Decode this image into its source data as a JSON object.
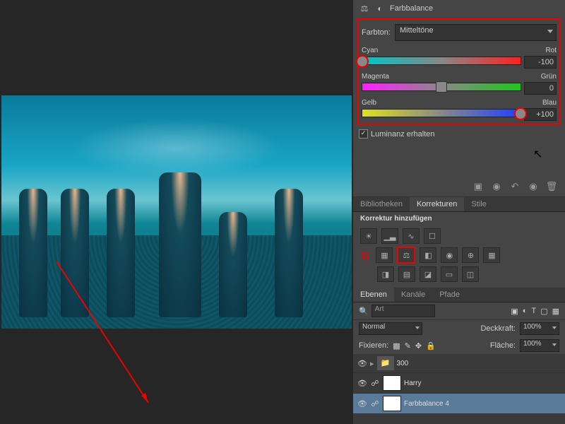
{
  "panel_title": "Farbbalance",
  "tone": {
    "label": "Farbton:",
    "value": "Mitteltöne"
  },
  "sliders": [
    {
      "left": "Cyan",
      "right": "Rot",
      "value": "-100",
      "pos": 0,
      "gradient": "linear-gradient(90deg,#00c5c5,#888,#ff2020)",
      "hl": true
    },
    {
      "left": "Magenta",
      "right": "Grün",
      "value": "0",
      "pos": 50,
      "gradient": "linear-gradient(90deg,#ff20ff,#888,#20c520)",
      "hl": false
    },
    {
      "left": "Gelb",
      "right": "Blau",
      "value": "+100",
      "pos": 100,
      "gradient": "linear-gradient(90deg,#e0e020,#888,#2040ff)",
      "hl": true
    }
  ],
  "preserve_lum": "Luminanz erhalten",
  "tabs1": {
    "items": [
      "Bibliotheken",
      "Korrekturen",
      "Stile"
    ],
    "active": 1
  },
  "add_adj": "Korrektur hinzufügen",
  "annot1": "1)",
  "tabs2": {
    "items": [
      "Ebenen",
      "Kanäle",
      "Pfade"
    ],
    "active": 0
  },
  "search_placeholder": "Art",
  "blend": "Normal",
  "opacity_label": "Deckkraft:",
  "opacity_value": "100%",
  "lock_label": "Fixieren:",
  "fill_label": "Fläche:",
  "fill_value": "100%",
  "layers": [
    {
      "name": "300",
      "type": "group",
      "eye": true,
      "sel": false
    },
    {
      "name": "Harry",
      "type": "adj",
      "eye": true,
      "sel": false
    },
    {
      "name": "Farbbalance 4",
      "type": "adj",
      "eye": true,
      "sel": true
    }
  ],
  "chart_data": {
    "type": "table",
    "title": "Farbbalance (Color Balance) adjustment values",
    "series": [
      {
        "name": "Cyan–Rot",
        "values": [
          -100
        ]
      },
      {
        "name": "Magenta–Grün",
        "values": [
          0
        ]
      },
      {
        "name": "Gelb–Blau",
        "values": [
          100
        ]
      }
    ],
    "range": [
      -100,
      100
    ],
    "tone": "Mitteltöne"
  }
}
